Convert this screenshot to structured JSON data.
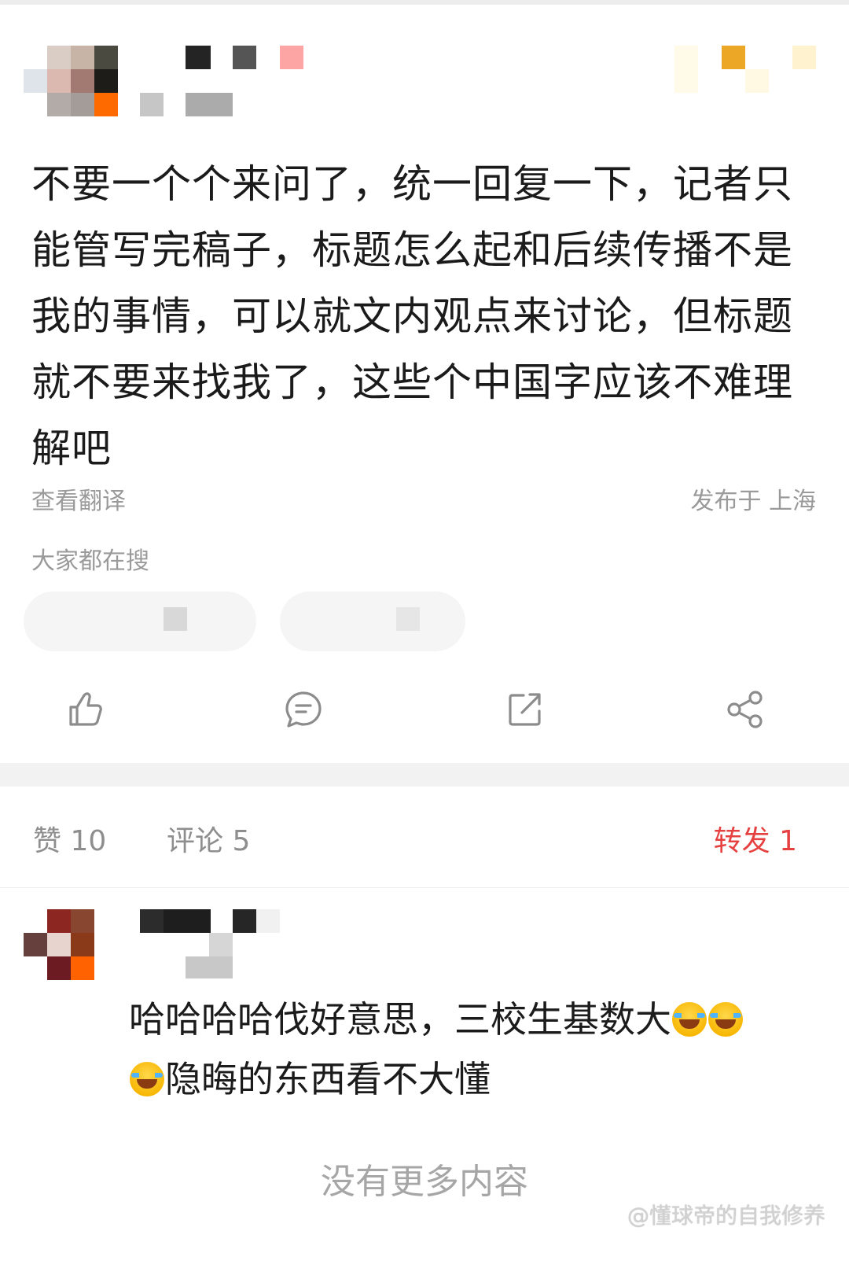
{
  "post": {
    "text": "不要一个个来问了，统一回复一下，记者只能管写完稿子，标题怎么起和后续传播不是我的事情，可以就文内观点来讨论，但标题就不要来找我了，这些个中国字应该不难理解吧",
    "translate_label": "查看翻译",
    "location_label": "发布于 上海",
    "search_section_label": "大家都在搜"
  },
  "actions": [
    {
      "name": "like",
      "icon": "thumbs-up-icon"
    },
    {
      "name": "comment",
      "icon": "comment-bubble-icon"
    },
    {
      "name": "repost",
      "icon": "external-share-icon"
    },
    {
      "name": "share",
      "icon": "share-nodes-icon"
    }
  ],
  "stats": {
    "likes": "赞 10",
    "comments": "评论 5",
    "reposts": "转发 1"
  },
  "comment": {
    "text_line1": "哈哈哈哈伐好意思，三校生基数大",
    "text_line2": "隐晦的东西看不大懂",
    "emoji": "laughing-tears-emoji"
  },
  "footer": {
    "no_more": "没有更多内容",
    "watermark": "@懂球帝的自我修养"
  },
  "colors": {
    "accent": "#e64141",
    "muted_text": "#9a9a9a",
    "divider": "#f2f2f2"
  }
}
